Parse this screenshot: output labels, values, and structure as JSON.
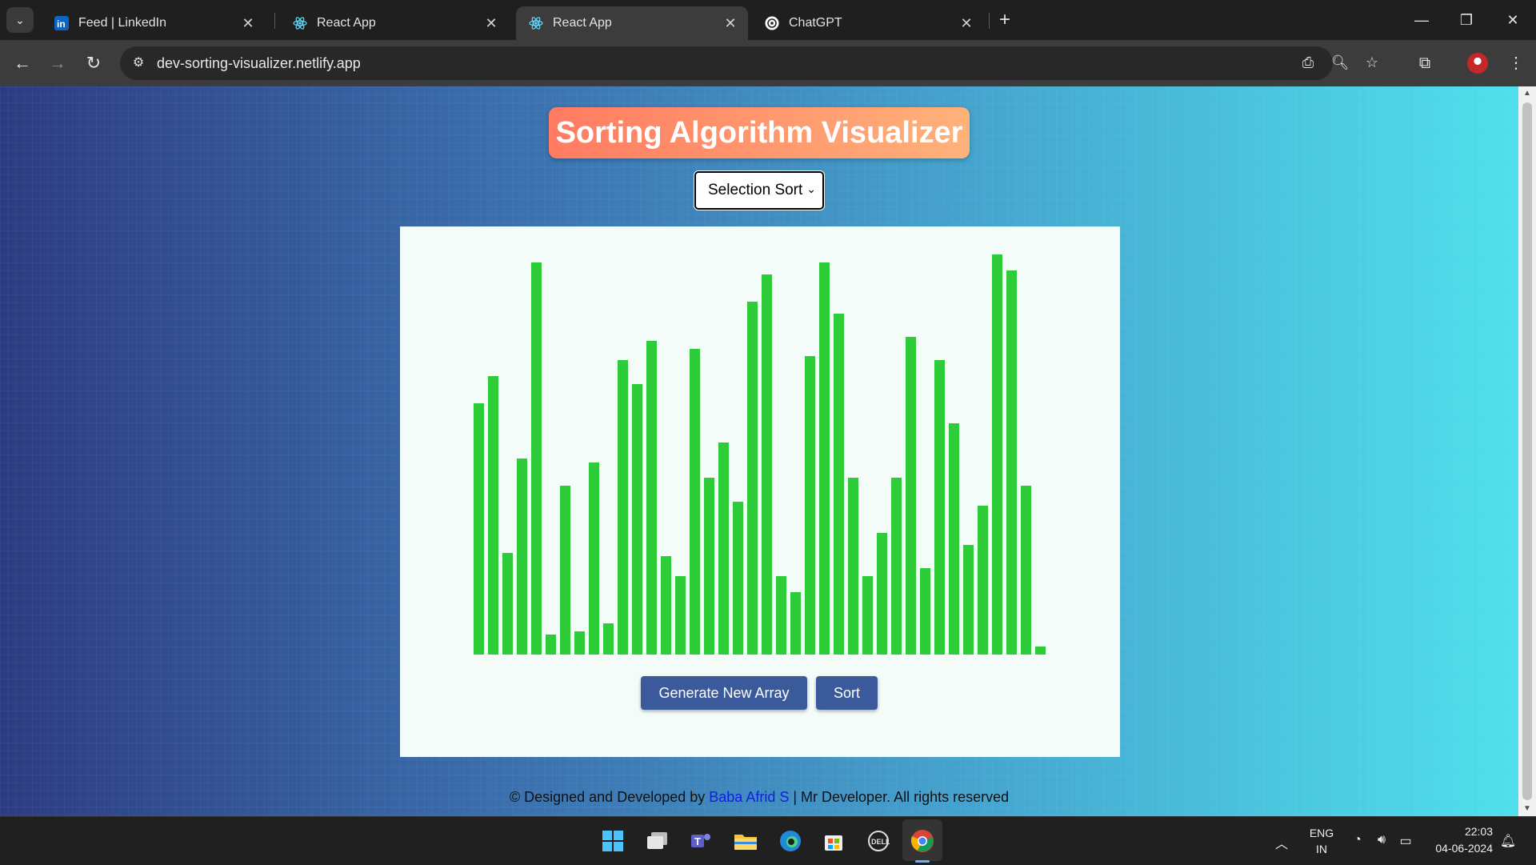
{
  "browser": {
    "tabs": [
      {
        "title": "Feed | LinkedIn",
        "icon": "linkedin-icon",
        "active": false
      },
      {
        "title": "React App",
        "icon": "react-icon",
        "active": false
      },
      {
        "title": "React App",
        "icon": "react-icon",
        "active": true
      },
      {
        "title": "ChatGPT",
        "icon": "chatgpt-icon",
        "active": false
      }
    ],
    "url": "dev-sorting-visualizer.netlify.app"
  },
  "app": {
    "title": "Sorting Algorithm Visualizer",
    "algorithm": {
      "selected": "Selection Sort"
    },
    "bar_color": "#2ecc38",
    "array_values": [
      64,
      71,
      26,
      50,
      100,
      5,
      43,
      6,
      49,
      8,
      75,
      69,
      80,
      25,
      20,
      78,
      45,
      54,
      39,
      90,
      97,
      20,
      16,
      76,
      100,
      87,
      45,
      20,
      31,
      45,
      81,
      22,
      75,
      59,
      28,
      38,
      102,
      98,
      43,
      2
    ],
    "buttons": {
      "generate": "Generate New Array",
      "sort": "Sort"
    },
    "footer": {
      "prefix": "© Designed and Developed by ",
      "author": "Baba Afrid S",
      "suffix": " | Mr Developer. All rights reserved"
    }
  },
  "taskbar": {
    "language": "ENG",
    "region": "IN",
    "time": "22:03",
    "date": "04-06-2024"
  }
}
